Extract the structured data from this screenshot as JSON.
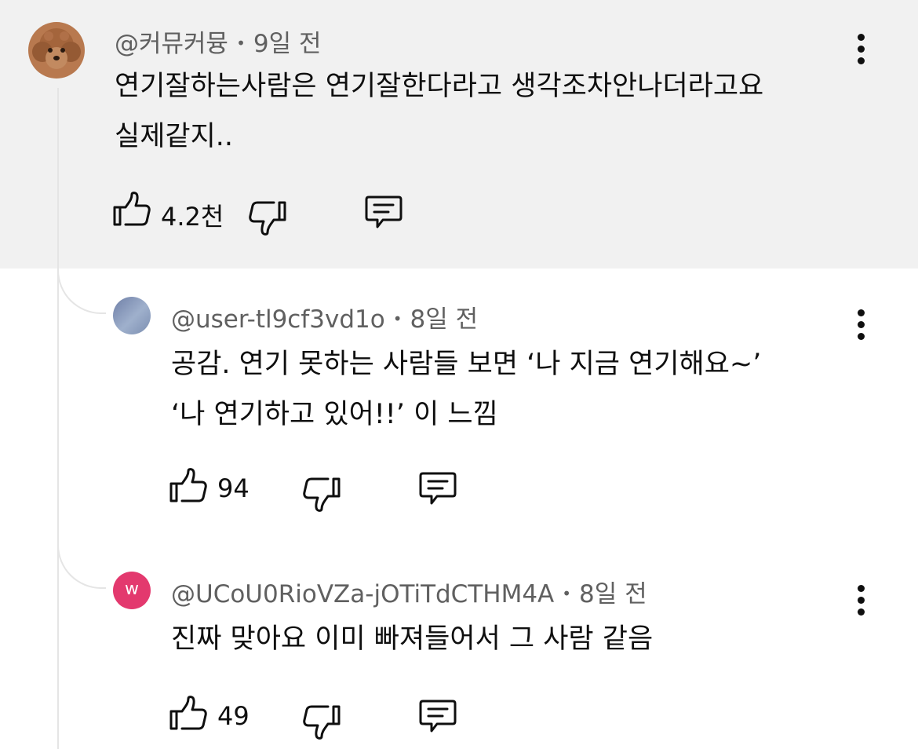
{
  "comments": [
    {
      "handle": "@커뮤커뮹",
      "time": "9일 전",
      "lines": [
        "연기잘하는사람은 연기잘한다라고 생각조차안나더라고요",
        "실제같지.."
      ],
      "likes": "4.2천",
      "avatar_icon": "poodle-avatar",
      "background": "#f1f1f1"
    },
    {
      "handle": "@user-tl9cf3vd1o",
      "time": "8일 전",
      "lines": [
        "공감. 연기 못하는 사람들 보면 ‘나 지금 연기해요~’",
        "‘나 연기하고 있어!!’ 이 느낌"
      ],
      "likes": "94",
      "avatar_icon": "gradient-avatar"
    },
    {
      "handle": "@UCoU0RioVZa-jOTiTdCTHM4A",
      "time": "8일 전",
      "lines": [
        "진짜 맞아요 이미 빠져들어서 그 사람 같음"
      ],
      "likes": "49",
      "avatar_letter": "w",
      "avatar_color": "#e3396e"
    }
  ],
  "separator": "•",
  "icons": {
    "like": "thumbs-up-icon",
    "dislike": "thumbs-down-icon",
    "reply": "reply-comment-icon",
    "more": "more-vert-icon"
  }
}
